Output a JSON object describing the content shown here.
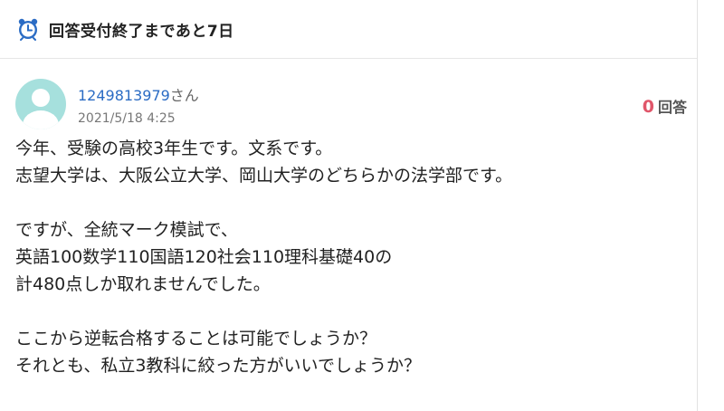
{
  "deadline": {
    "icon": "alarm-clock-icon",
    "text": "回答受付終了まであと7日",
    "icon_color": "#2b6cc4"
  },
  "question": {
    "user": {
      "name": "1249813979",
      "suffix": "さん",
      "avatar_icon": "user-avatar-icon"
    },
    "date": "2021/5/18 4:25",
    "answer_count": {
      "number": "0",
      "label": "回答"
    },
    "body_lines": [
      "今年、受験の高校3年生です。文系です。",
      "志望大学は、大阪公立大学、岡山大学のどちらかの法学部です。",
      "",
      "ですが、全統マーク模試で、",
      "英語100数学110国語120社会110理科基礎40の",
      "計480点しか取れませんでした。",
      "",
      "ここから逆転合格することは可能でしょうか？",
      "それとも、私立3教科に絞った方がいいでしょうか？"
    ]
  }
}
